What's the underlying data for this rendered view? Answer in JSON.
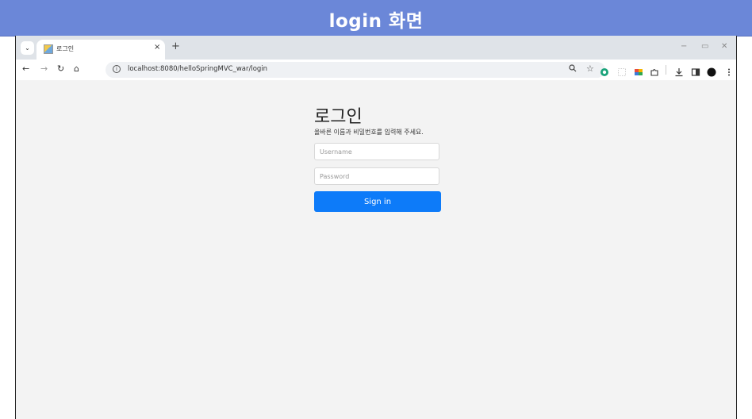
{
  "banner": {
    "title": "login 화면"
  },
  "browser": {
    "tab": {
      "title": "로그인",
      "close": "×"
    },
    "new_tab": "+",
    "window_controls": {
      "minimize": "−",
      "restore": "▭",
      "close": "✕"
    },
    "nav": {
      "back": "←",
      "forward": "→",
      "reload": "↻",
      "home": "⌂"
    },
    "url": "localhost:8080/helloSpringMVC_war/login",
    "icons": [
      "zoom-icon",
      "bookmark-star-icon",
      "extension-chatgpt-icon",
      "extension-placeholder-icon",
      "extension-color-icon",
      "puzzle-extensions-icon",
      "download-icon",
      "side-panel-icon",
      "profile-avatar-icon",
      "menu-kebab-icon"
    ]
  },
  "login": {
    "title": "로그인",
    "subtitle": "올바른 이름과 비밀번호를 입력해 주세요.",
    "username_placeholder": "Username",
    "password_placeholder": "Password",
    "submit_label": "Sign in",
    "accent_color": "#0d7bf9"
  }
}
